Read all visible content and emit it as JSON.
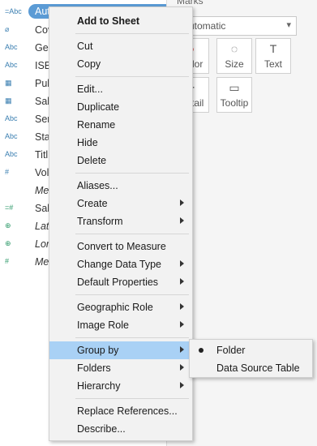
{
  "data_pane": {
    "selected_field": {
      "icon": "=Abc",
      "label": "Author Name"
    },
    "fields": [
      {
        "icon": "clip-icon",
        "glyph": "⌀",
        "label": "Cov"
      },
      {
        "icon": "abc-icon",
        "glyph": "Abc",
        "label": "Gen"
      },
      {
        "icon": "abc-icon",
        "glyph": "Abc",
        "label": "ISB"
      },
      {
        "icon": "calendar-icon",
        "glyph": "▦",
        "label": "Pub"
      },
      {
        "icon": "calendar-icon",
        "glyph": "▦",
        "label": "Sal"
      },
      {
        "icon": "abc-icon",
        "glyph": "Abc",
        "label": "Ser"
      },
      {
        "icon": "abc-icon",
        "glyph": "Abc",
        "label": "Sta"
      },
      {
        "icon": "abc-icon",
        "glyph": "Abc",
        "label": "Titl"
      },
      {
        "icon": "hash-icon",
        "glyph": "#",
        "label": "Vol"
      },
      {
        "icon": "none",
        "glyph": "",
        "label": "Me",
        "italic": true
      },
      {
        "icon": "calc-hash-icon",
        "glyph": "=#",
        "label": "Sal"
      },
      {
        "icon": "globe-icon",
        "glyph": "⊕",
        "label": "Lat",
        "italic": true
      },
      {
        "icon": "globe-icon",
        "glyph": "⊕",
        "label": "Lon",
        "italic": true
      },
      {
        "icon": "hash-icon",
        "glyph": "#",
        "label": "Me",
        "italic": true
      }
    ]
  },
  "marks_pane": {
    "title": "Marks",
    "mark_type": "Automatic",
    "buttons": [
      {
        "label": "Color",
        "glyph": "●"
      },
      {
        "label": "Size",
        "glyph": "◌"
      },
      {
        "label": "Text",
        "glyph": "T"
      },
      {
        "label": "Detail",
        "glyph": "⁘"
      },
      {
        "label": "Tooltip",
        "glyph": "▭"
      }
    ]
  },
  "context_menu": {
    "items": [
      {
        "label": "Add to Sheet",
        "bold": true
      },
      {
        "label": "Cut"
      },
      {
        "label": "Copy"
      },
      {
        "label": "Edit..."
      },
      {
        "label": "Duplicate"
      },
      {
        "label": "Rename"
      },
      {
        "label": "Hide"
      },
      {
        "label": "Delete"
      },
      {
        "label": "Aliases..."
      },
      {
        "label": "Create",
        "submenu": true
      },
      {
        "label": "Transform",
        "submenu": true
      },
      {
        "label": "Convert to Measure"
      },
      {
        "label": "Change Data Type",
        "submenu": true
      },
      {
        "label": "Default Properties",
        "submenu": true
      },
      {
        "label": "Geographic Role",
        "submenu": true
      },
      {
        "label": "Image Role",
        "submenu": true
      },
      {
        "label": "Group by",
        "submenu": true,
        "highlighted": true
      },
      {
        "label": "Folders",
        "submenu": true
      },
      {
        "label": "Hierarchy",
        "submenu": true
      },
      {
        "label": "Replace References..."
      },
      {
        "label": "Describe..."
      }
    ]
  },
  "group_by_submenu": {
    "items": [
      {
        "label": "Folder",
        "selected": true
      },
      {
        "label": "Data Source Table",
        "selected": false
      }
    ]
  },
  "colors": {
    "accent": "#5b9bd5",
    "highlight": "#a9d1f5",
    "menu_bg": "#f2f2f2"
  }
}
